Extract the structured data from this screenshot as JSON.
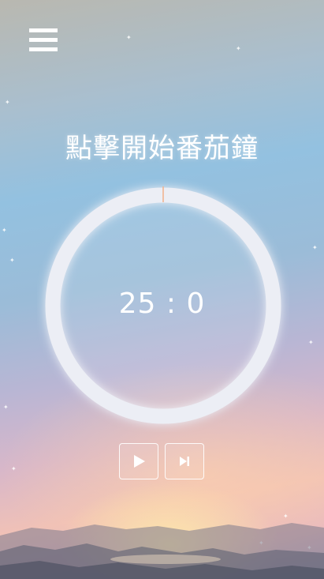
{
  "header": {
    "menu_icon": "hamburger-menu-icon"
  },
  "main": {
    "title": "點擊開始番茄鐘",
    "timer": {
      "display": "25 : 0",
      "progress": 0.0
    },
    "controls": {
      "play_icon": "play-icon",
      "skip_icon": "skip-next-icon"
    }
  },
  "colors": {
    "ring": "#eceef5",
    "ring_marker": "#f2b08a",
    "text": "#ffffff"
  }
}
